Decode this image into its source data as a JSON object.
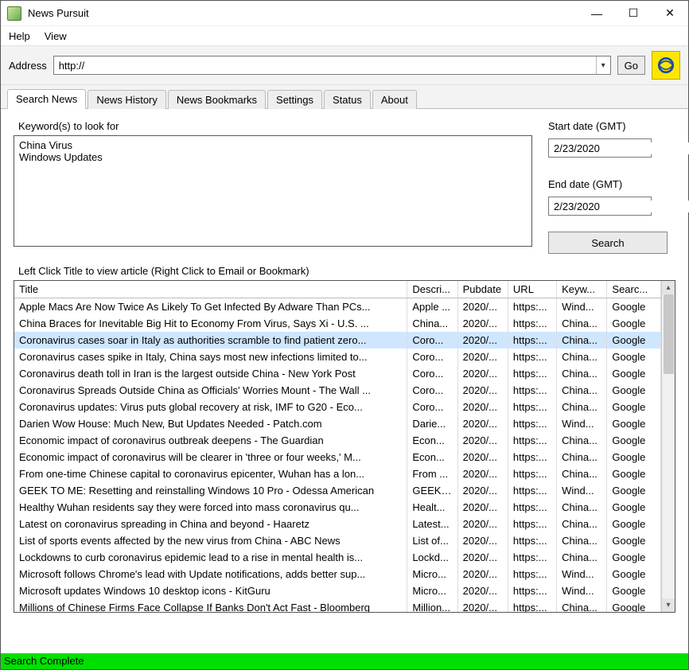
{
  "window": {
    "title": "News Pursuit"
  },
  "menu": {
    "help": "Help",
    "view": "View"
  },
  "address": {
    "label": "Address",
    "value": "http://",
    "go": "Go"
  },
  "tabs": {
    "search_news": "Search News",
    "news_history": "News History",
    "news_bookmarks": "News Bookmarks",
    "settings": "Settings",
    "status": "Status",
    "about": "About"
  },
  "search": {
    "keywords_label": "Keyword(s) to look for",
    "keywords_value": "China Virus\nWindows Updates",
    "start_label": "Start date (GMT)",
    "start_value": "2/23/2020",
    "end_label": "End date (GMT)",
    "end_value": "2/23/2020",
    "button": "Search"
  },
  "hint": "Left Click Title to view article (Right Click to Email or Bookmark)",
  "columns": {
    "title": "Title",
    "descr": "Descri...",
    "pubdate": "Pubdate",
    "url": "URL",
    "keyw": "Keyw...",
    "searc": "Searc..."
  },
  "rows": [
    {
      "title": "Apple Macs Are Now Twice As Likely To Get Infected By Adware Than PCs...",
      "descr": "Apple ...",
      "pub": "2020/...",
      "url": "https:...",
      "keyw": "Wind...",
      "searc": "Google",
      "sel": false
    },
    {
      "title": "China Braces for Inevitable Big Hit to Economy From Virus, Says Xi - U.S. ...",
      "descr": "China...",
      "pub": "2020/...",
      "url": "https:...",
      "keyw": "China...",
      "searc": "Google",
      "sel": false
    },
    {
      "title": "Coronavirus cases soar in Italy as authorities scramble to find patient zero...",
      "descr": "Coro...",
      "pub": "2020/...",
      "url": "https:...",
      "keyw": "China...",
      "searc": "Google",
      "sel": true
    },
    {
      "title": "Coronavirus cases spike in Italy, China says most new infections limited to...",
      "descr": "Coro...",
      "pub": "2020/...",
      "url": "https:...",
      "keyw": "China...",
      "searc": "Google",
      "sel": false
    },
    {
      "title": "Coronavirus death toll in Iran is the largest outside China - New York Post",
      "descr": "Coro...",
      "pub": "2020/...",
      "url": "https:...",
      "keyw": "China...",
      "searc": "Google",
      "sel": false
    },
    {
      "title": "Coronavirus Spreads Outside China as Officials' Worries Mount - The Wall ...",
      "descr": "Coro...",
      "pub": "2020/...",
      "url": "https:...",
      "keyw": "China...",
      "searc": "Google",
      "sel": false
    },
    {
      "title": "Coronavirus updates: Virus puts global recovery at risk, IMF to G20 - Eco...",
      "descr": "Coro...",
      "pub": "2020/...",
      "url": "https:...",
      "keyw": "China...",
      "searc": "Google",
      "sel": false
    },
    {
      "title": "Darien Wow House: Much New, But Updates Needed - Patch.com",
      "descr": "Darie...",
      "pub": "2020/...",
      "url": "https:...",
      "keyw": "Wind...",
      "searc": "Google",
      "sel": false
    },
    {
      "title": "Economic impact of coronavirus outbreak deepens - The Guardian",
      "descr": "Econ...",
      "pub": "2020/...",
      "url": "https:...",
      "keyw": "China...",
      "searc": "Google",
      "sel": false
    },
    {
      "title": "Economic impact of coronavirus will be clearer in 'three or four weeks,' M...",
      "descr": "Econ...",
      "pub": "2020/...",
      "url": "https:...",
      "keyw": "China...",
      "searc": "Google",
      "sel": false
    },
    {
      "title": "From one-time Chinese capital to coronavirus epicenter, Wuhan has a lon...",
      "descr": "From ...",
      "pub": "2020/...",
      "url": "https:...",
      "keyw": "China...",
      "searc": "Google",
      "sel": false
    },
    {
      "title": "GEEK TO ME: Resetting and reinstalling Windows 10 Pro - Odessa American",
      "descr": "GEEK ...",
      "pub": "2020/...",
      "url": "https:...",
      "keyw": "Wind...",
      "searc": "Google",
      "sel": false
    },
    {
      "title": "Healthy Wuhan residents say they were forced into mass coronavirus qu...",
      "descr": "Healt...",
      "pub": "2020/...",
      "url": "https:...",
      "keyw": "China...",
      "searc": "Google",
      "sel": false
    },
    {
      "title": "Latest on coronavirus spreading in China and beyond - Haaretz",
      "descr": "Latest...",
      "pub": "2020/...",
      "url": "https:...",
      "keyw": "China...",
      "searc": "Google",
      "sel": false
    },
    {
      "title": "List of sports events affected by the new virus from China - ABC News",
      "descr": "List of...",
      "pub": "2020/...",
      "url": "https:...",
      "keyw": "China...",
      "searc": "Google",
      "sel": false
    },
    {
      "title": "Lockdowns to curb coronavirus epidemic lead to a rise in mental health is...",
      "descr": "Lockd...",
      "pub": "2020/...",
      "url": "https:...",
      "keyw": "China...",
      "searc": "Google",
      "sel": false
    },
    {
      "title": "Microsoft follows Chrome's lead with Update notifications, adds better sup...",
      "descr": "Micro...",
      "pub": "2020/...",
      "url": "https:...",
      "keyw": "Wind...",
      "searc": "Google",
      "sel": false
    },
    {
      "title": "Microsoft updates Windows 10 desktop icons - KitGuru",
      "descr": "Micro...",
      "pub": "2020/...",
      "url": "https:...",
      "keyw": "Wind...",
      "searc": "Google",
      "sel": false
    },
    {
      "title": "Millions of Chinese Firms Face Collapse If Banks Don't Act Fast - Bloomberg",
      "descr": "Million...",
      "pub": "2020/...",
      "url": "https:...",
      "keyw": "China...",
      "searc": "Google",
      "sel": false
    }
  ],
  "status": "Search Complete"
}
